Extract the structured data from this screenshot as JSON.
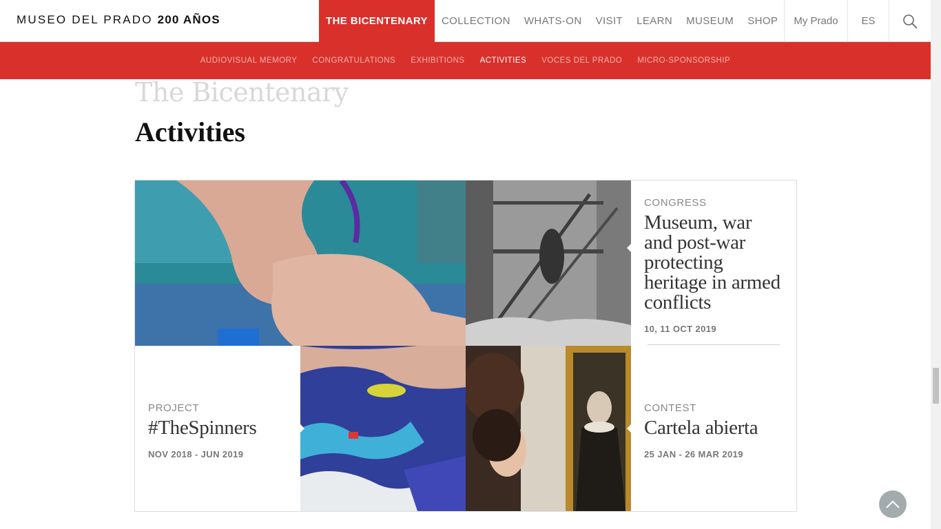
{
  "header": {
    "logo_text": "MUSEO DEL PRADO",
    "logo_strong": "200 AÑOS",
    "nav": [
      {
        "label": "THE BICENTENARY",
        "active": true
      },
      {
        "label": "COLLECTION"
      },
      {
        "label": "WHATS-ON"
      },
      {
        "label": "VISIT"
      },
      {
        "label": "LEARN"
      },
      {
        "label": "MUSEUM"
      },
      {
        "label": "SHOP"
      }
    ],
    "my_prado": "My Prado",
    "lang": "ES",
    "search_icon": "search-icon"
  },
  "subnav": [
    {
      "label": "AUDIOVISUAL MEMORY"
    },
    {
      "label": "CONGRATULATIONS"
    },
    {
      "label": "EXHIBITIONS"
    },
    {
      "label": "ACTIVITIES",
      "active": true
    },
    {
      "label": "VOCES DEL PRADO"
    },
    {
      "label": "MICRO-SPONSORSHIP"
    }
  ],
  "section_title": "The Bicentenary",
  "page_title": "Activities",
  "cards": [
    {
      "category": "CONGRESS",
      "title": "Museum, war and post-war protecting heritage in armed conflicts",
      "date": "10, 11 OCT 2019"
    },
    {
      "category": "PROJECT",
      "title": "#TheSpinners",
      "date": "NOV 2018 - JUN 2019"
    },
    {
      "category": "CONTEST",
      "title": "Cartela abierta",
      "date": "25 JAN - 26 MAR 2019"
    }
  ],
  "colors": {
    "accent": "#d9302b"
  },
  "back_to_top_icon": "chevron-up-icon"
}
